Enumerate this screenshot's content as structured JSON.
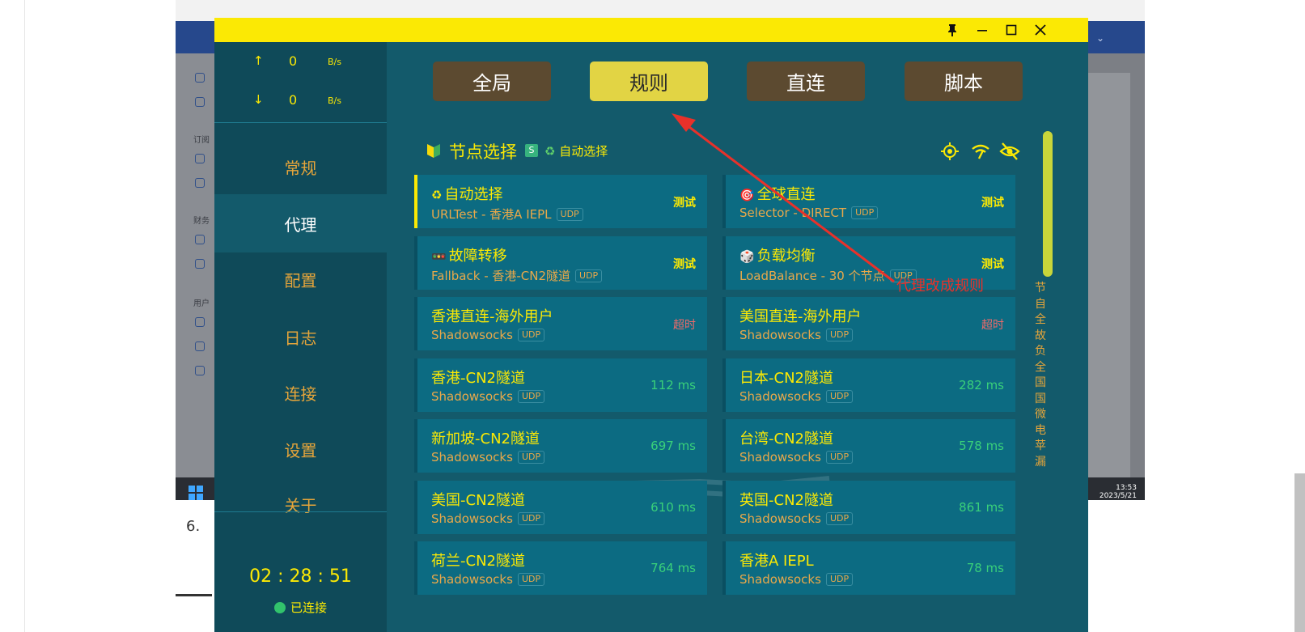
{
  "background": {
    "step_number": "6.",
    "taskbar_time": "13:53",
    "taskbar_date": "2023/5/21",
    "sidebar_labels": [
      "订阅",
      "财务",
      "用户"
    ]
  },
  "window": {
    "pin_icon": "pin-icon",
    "minimize_icon": "minimize-icon",
    "maximize_icon": "maximize-icon",
    "close_icon": "close-icon"
  },
  "traffic": {
    "up_arrow": "↑",
    "up_value": "0",
    "up_unit": "B/s",
    "down_arrow": "↓",
    "down_value": "0",
    "down_unit": "B/s"
  },
  "nav": {
    "items": [
      {
        "label": "常规"
      },
      {
        "label": "代理"
      },
      {
        "label": "配置"
      },
      {
        "label": "日志"
      },
      {
        "label": "连接"
      },
      {
        "label": "设置"
      },
      {
        "label": "关于"
      }
    ],
    "active_index": 1
  },
  "session": {
    "timer": "02 : 28 : 51",
    "status": "已连接",
    "status_color": "#32c36c"
  },
  "modes": {
    "items": [
      {
        "label": "全局"
      },
      {
        "label": "规则"
      },
      {
        "label": "直连"
      },
      {
        "label": "脚本"
      }
    ],
    "active_index": 1
  },
  "group": {
    "title": "节点选择",
    "badge": "S",
    "selected": "自动选择",
    "selected_emoji": "♻",
    "header_icons": [
      "locate-icon",
      "speed-test-icon",
      "hide-icon"
    ]
  },
  "proxies": [
    {
      "emoji": "♻",
      "name": "自动选择",
      "type": "URLTest - 香港A IEPL",
      "udp": "UDP",
      "delay": "测试",
      "delay_kind": "test"
    },
    {
      "emoji": "🎯",
      "name": "全球直连",
      "type": "Selector - DIRECT",
      "udp": "UDP",
      "delay": "测试",
      "delay_kind": "test"
    },
    {
      "emoji": "🚥",
      "name": "故障转移",
      "type": "Fallback - 香港-CN2隧道",
      "udp": "UDP",
      "delay": "测试",
      "delay_kind": "test"
    },
    {
      "emoji": "🎲",
      "name": "负载均衡",
      "type": "LoadBalance - 30 个节点",
      "udp": "UDP",
      "delay": "测试",
      "delay_kind": "test"
    },
    {
      "emoji": "",
      "name": "香港直连-海外用户",
      "type": "Shadowsocks",
      "udp": "UDP",
      "delay": "超时",
      "delay_kind": "timeout"
    },
    {
      "emoji": "",
      "name": "美国直连-海外用户",
      "type": "Shadowsocks",
      "udp": "UDP",
      "delay": "超时",
      "delay_kind": "timeout"
    },
    {
      "emoji": "",
      "name": "香港-CN2隧道",
      "type": "Shadowsocks",
      "udp": "UDP",
      "delay": "112 ms",
      "delay_kind": "good"
    },
    {
      "emoji": "",
      "name": "日本-CN2隧道",
      "type": "Shadowsocks",
      "udp": "UDP",
      "delay": "282 ms",
      "delay_kind": "good"
    },
    {
      "emoji": "",
      "name": "新加坡-CN2隧道",
      "type": "Shadowsocks",
      "udp": "UDP",
      "delay": "697 ms",
      "delay_kind": "good"
    },
    {
      "emoji": "",
      "name": "台湾-CN2隧道",
      "type": "Shadowsocks",
      "udp": "UDP",
      "delay": "578 ms",
      "delay_kind": "good"
    },
    {
      "emoji": "",
      "name": "美国-CN2隧道",
      "type": "Shadowsocks",
      "udp": "UDP",
      "delay": "610 ms",
      "delay_kind": "good"
    },
    {
      "emoji": "",
      "name": "英国-CN2隧道",
      "type": "Shadowsocks",
      "udp": "UDP",
      "delay": "861 ms",
      "delay_kind": "good"
    },
    {
      "emoji": "",
      "name": "荷兰-CN2隧道",
      "type": "Shadowsocks",
      "udp": "UDP",
      "delay": "764 ms",
      "delay_kind": "good"
    },
    {
      "emoji": "",
      "name": "香港A IEPL",
      "type": "Shadowsocks",
      "udp": "UDP",
      "delay": "78 ms",
      "delay_kind": "good"
    }
  ],
  "group_index": [
    "节",
    "自",
    "全",
    "故",
    "负",
    "全",
    "国",
    "国",
    "微",
    "电",
    "苹",
    "漏"
  ],
  "annotation": {
    "text": "代理改成规则",
    "color": "#e8312a"
  },
  "colors": {
    "title_bar": "#fbe904",
    "accent_yellow": "#fbe904",
    "sidebar_bg": "#0f4a59",
    "main_bg": "#135a6b",
    "card_bg": "#0c6b82",
    "mode_btn": "#5c4a30",
    "mode_btn_active": "#e2d444",
    "nav_text": "#e6a53a",
    "delay_good": "#39d07a",
    "delay_timeout": "#ef6a6a"
  }
}
